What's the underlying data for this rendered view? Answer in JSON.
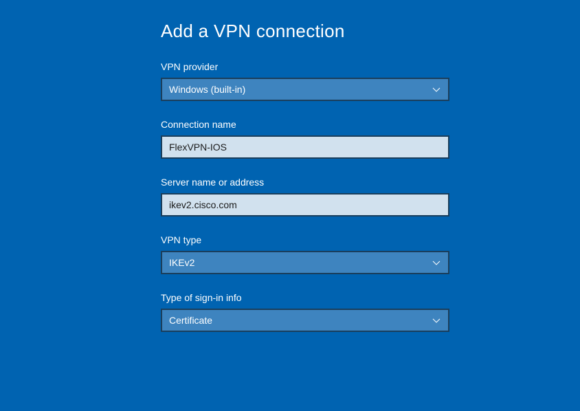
{
  "title": "Add a VPN connection",
  "fields": {
    "provider": {
      "label": "VPN provider",
      "value": "Windows (built-in)"
    },
    "connection_name": {
      "label": "Connection name",
      "value": "FlexVPN-IOS"
    },
    "server": {
      "label": "Server name or address",
      "value": "ikev2.cisco.com"
    },
    "vpn_type": {
      "label": "VPN type",
      "value": "IKEv2"
    },
    "signin_type": {
      "label": "Type of sign-in info",
      "value": "Certificate"
    }
  }
}
